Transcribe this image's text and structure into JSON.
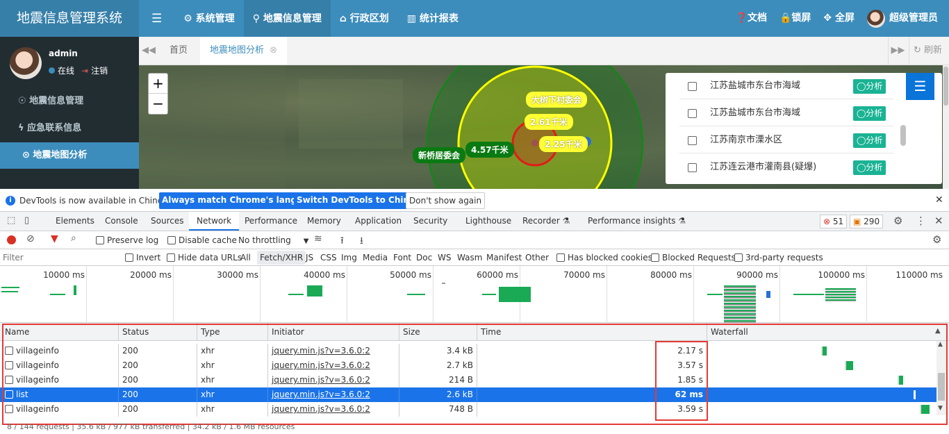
{
  "app": {
    "logo": "地震信息管理系统",
    "nav": [
      {
        "icon": "gear-icon",
        "label": "⚙ 系统管理"
      },
      {
        "icon": "map-pin-icon",
        "label": "⚲ 地震信息管理"
      },
      {
        "icon": "bank-icon",
        "label": "⌂ 行政区划"
      },
      {
        "icon": "chart-icon",
        "label": "▥ 统计报表"
      }
    ],
    "nav_right": [
      {
        "icon": "question-icon",
        "label": "❓文档"
      },
      {
        "icon": "lock-icon",
        "label": "🔒锁屏"
      },
      {
        "icon": "fullscreen-icon",
        "label": "✥ 全屏"
      }
    ],
    "admin_label": "超级管理员",
    "user": {
      "name": "admin",
      "status": "在线",
      "logout": "注销"
    },
    "sidebar": [
      {
        "label": "☉ 地震信息管理"
      },
      {
        "label": "ϟ 应急联系信息"
      },
      {
        "label": "⊙ 地震地图分析"
      }
    ],
    "tabs": {
      "home": "首页",
      "active": "地震地图分析",
      "refresh": "↻ 刷新"
    },
    "map": {
      "zoom_in": "+",
      "zoom_out": "−",
      "labels": [
        "大树下村委会",
        "2.61千米",
        "2.25千米",
        "4.57千米",
        "新桥居委会"
      ]
    },
    "panel": {
      "rows": [
        {
          "text": "江苏盐城市东台市海域",
          "btn": "◯分析"
        },
        {
          "text": "江苏盐城市东台市海域",
          "btn": "◯分析"
        },
        {
          "text": "江苏南京市溧水区",
          "btn": "◯分析"
        },
        {
          "text": "江苏连云港市灌南县(疑爆)",
          "btn": "◯分析"
        }
      ]
    }
  },
  "devtools": {
    "info": "DevTools is now available in Chinese!",
    "btn_match": "Always match Chrome's language",
    "btn_switch": "Switch DevTools to Chinese",
    "btn_dont": "Don't show again",
    "tabs": [
      "Elements",
      "Console",
      "Sources",
      "Network",
      "Performance",
      "Memory",
      "Application",
      "Security",
      "Lighthouse",
      "Recorder ⚗",
      "Performance insights ⚗"
    ],
    "errors": "51",
    "warnings": "290",
    "toolbar": {
      "preserve": "Preserve log",
      "disable_cache": "Disable cache",
      "throttle": "No throttling"
    },
    "filter": {
      "placeholder": "Filter",
      "invert": "Invert",
      "hide_data": "Hide data URLs",
      "types": [
        "All",
        "Fetch/XHR",
        "JS",
        "CSS",
        "Img",
        "Media",
        "Font",
        "Doc",
        "WS",
        "Wasm",
        "Manifest",
        "Other"
      ],
      "blocked_cookies": "Has blocked cookies",
      "blocked_requests": "Blocked Requests",
      "third_party": "3rd-party requests"
    },
    "overview_ticks": [
      "10000 ms",
      "20000 ms",
      "30000 ms",
      "40000 ms",
      "50000 ms",
      "60000 ms",
      "70000 ms",
      "80000 ms",
      "90000 ms",
      "100000 ms",
      "110000 ms"
    ],
    "columns": [
      "Name",
      "Status",
      "Type",
      "Initiator",
      "Size",
      "Time",
      "Waterfall"
    ],
    "rows": [
      {
        "name": "villageinfo",
        "status": "200",
        "type": "xhr",
        "initiator": "jquery.min.js?v=3.6.0:2",
        "size": "3.4 kB",
        "time": "2.17 s"
      },
      {
        "name": "villageinfo",
        "status": "200",
        "type": "xhr",
        "initiator": "jquery.min.js?v=3.6.0:2",
        "size": "2.7 kB",
        "time": "3.57 s"
      },
      {
        "name": "villageinfo",
        "status": "200",
        "type": "xhr",
        "initiator": "jquery.min.js?v=3.6.0:2",
        "size": "214 B",
        "time": "1.85 s"
      },
      {
        "name": "list",
        "status": "200",
        "type": "xhr",
        "initiator": "jquery.min.js?v=3.6.0:2",
        "size": "2.6 kB",
        "time": "62 ms"
      },
      {
        "name": "villageinfo",
        "status": "200",
        "type": "xhr",
        "initiator": "jquery.min.js?v=3.6.0:2",
        "size": "748 B",
        "time": "3.59 s"
      }
    ],
    "status_text": "8 / 144 requests | 35.6 kB / 977 kB transferred | 34.2 kB / 1.6 MB resources"
  }
}
